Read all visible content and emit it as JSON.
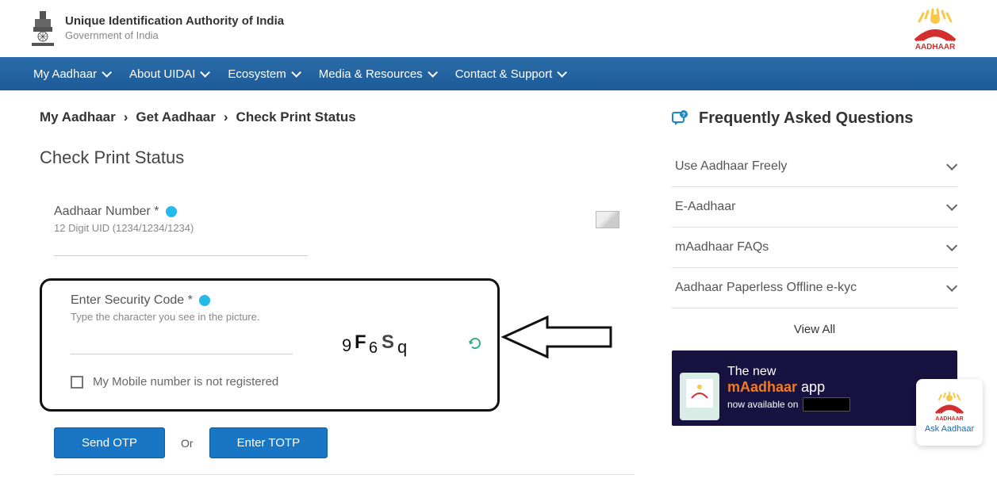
{
  "header": {
    "org_title": "Unique Identification Authority of India",
    "org_sub": "Government of India",
    "logo_text": "AADHAAR"
  },
  "nav": {
    "items": [
      "My Aadhaar",
      "About UIDAI",
      "Ecosystem",
      "Media & Resources",
      "Contact & Support"
    ]
  },
  "breadcrumb": {
    "items": [
      "My Aadhaar",
      "Get Aadhaar",
      "Check Print Status"
    ]
  },
  "page": {
    "title": "Check Print Status"
  },
  "form": {
    "aadhaar_label": "Aadhaar Number *",
    "aadhaar_hint": "12 Digit UID (1234/1234/1234)",
    "security_label": "Enter Security Code *",
    "security_hint": "Type the character you see in the picture.",
    "captcha_text": "9F6Sq",
    "checkbox_label": "My Mobile number is not registered",
    "send_otp": "Send OTP",
    "or": "Or",
    "enter_totp": "Enter TOTP"
  },
  "faq": {
    "title": "Frequently Asked Questions",
    "items": [
      "Use Aadhaar Freely",
      "E-Aadhaar",
      "mAadhaar FAQs",
      "Aadhaar Paperless Offline e-kyc"
    ],
    "view_all": "View All"
  },
  "promo": {
    "line1": "The new",
    "line2a": "mAadhaar ",
    "line2b": "app",
    "line3": "now available on"
  },
  "ask": {
    "label": "Ask Aadhaar"
  }
}
